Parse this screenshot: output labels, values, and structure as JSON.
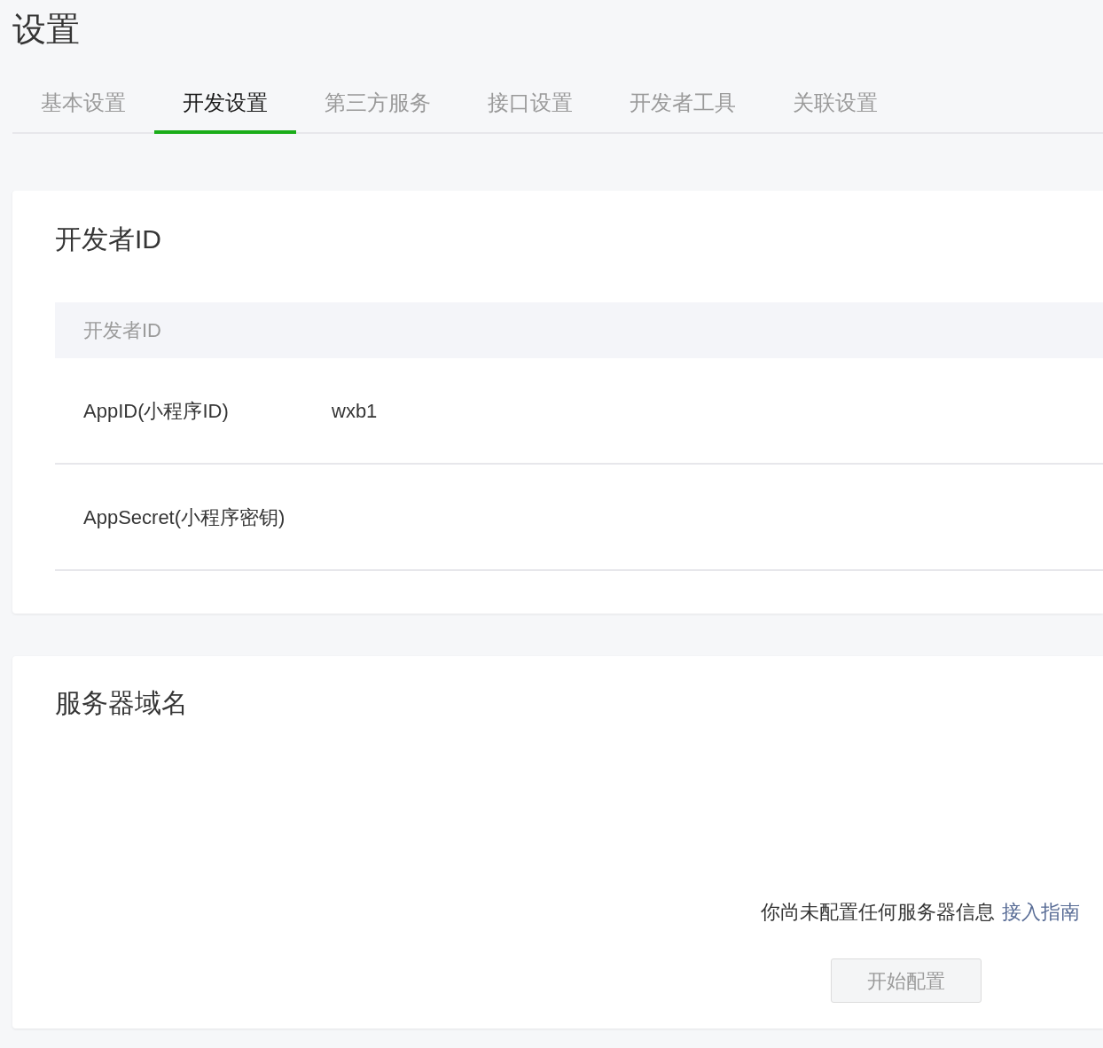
{
  "page_title": "设置",
  "tabs": [
    {
      "label": "基本设置",
      "selected": false
    },
    {
      "label": "开发设置",
      "selected": true
    },
    {
      "label": "第三方服务",
      "selected": false
    },
    {
      "label": "接口设置",
      "selected": false
    },
    {
      "label": "开发者工具",
      "selected": false
    },
    {
      "label": "关联设置",
      "selected": false
    }
  ],
  "developer_id": {
    "title": "开发者ID",
    "table_header": "开发者ID",
    "rows": [
      {
        "label": "AppID(小程序ID)",
        "value": "wxb1"
      },
      {
        "label": "AppSecret(小程序密钥)"
      }
    ]
  },
  "server_domain": {
    "title": "服务器域名",
    "message": "你尚未配置任何服务器信息",
    "link": "接入指南",
    "button": {
      "label": "开始配置",
      "disabled": true
    }
  }
}
